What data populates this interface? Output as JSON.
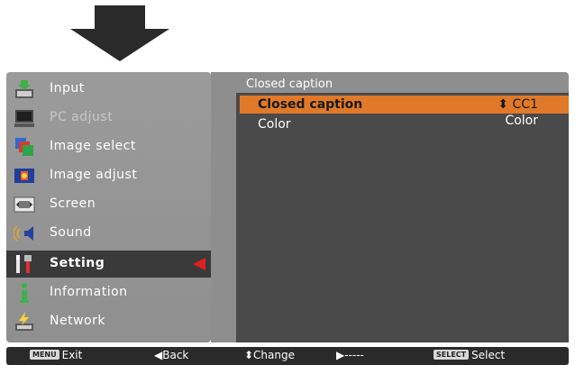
{
  "left_menu": {
    "items": [
      {
        "label": "Input",
        "icon": "input-icon"
      },
      {
        "label": "PC adjust",
        "icon": "pc-adjust-icon"
      },
      {
        "label": "Image select",
        "icon": "image-select-icon"
      },
      {
        "label": "Image adjust",
        "icon": "image-adjust-icon"
      },
      {
        "label": "Screen",
        "icon": "screen-icon"
      },
      {
        "label": "Sound",
        "icon": "sound-icon"
      },
      {
        "label": "Setting",
        "icon": "setting-icon"
      },
      {
        "label": "Information",
        "icon": "information-icon"
      },
      {
        "label": "Network",
        "icon": "network-icon"
      }
    ],
    "selected": "Setting"
  },
  "panel": {
    "title": "Closed caption",
    "rows": [
      {
        "name": "Closed caption",
        "value": "CC1",
        "value_prefix": "⬍"
      },
      {
        "name": "Color",
        "value": "Color"
      }
    ]
  },
  "statusbar": {
    "exit": {
      "key": "MENU",
      "label": "Exit"
    },
    "back": {
      "label": "◀Back"
    },
    "change": {
      "label": "⬍Change"
    },
    "next": {
      "label": "▶-----"
    },
    "select": {
      "key": "SELECT",
      "label": "Select"
    }
  },
  "colors": {
    "highlight": "#e07a2a",
    "selector_arrow": "#e02020",
    "panel_bg": "#4a4a4a"
  }
}
